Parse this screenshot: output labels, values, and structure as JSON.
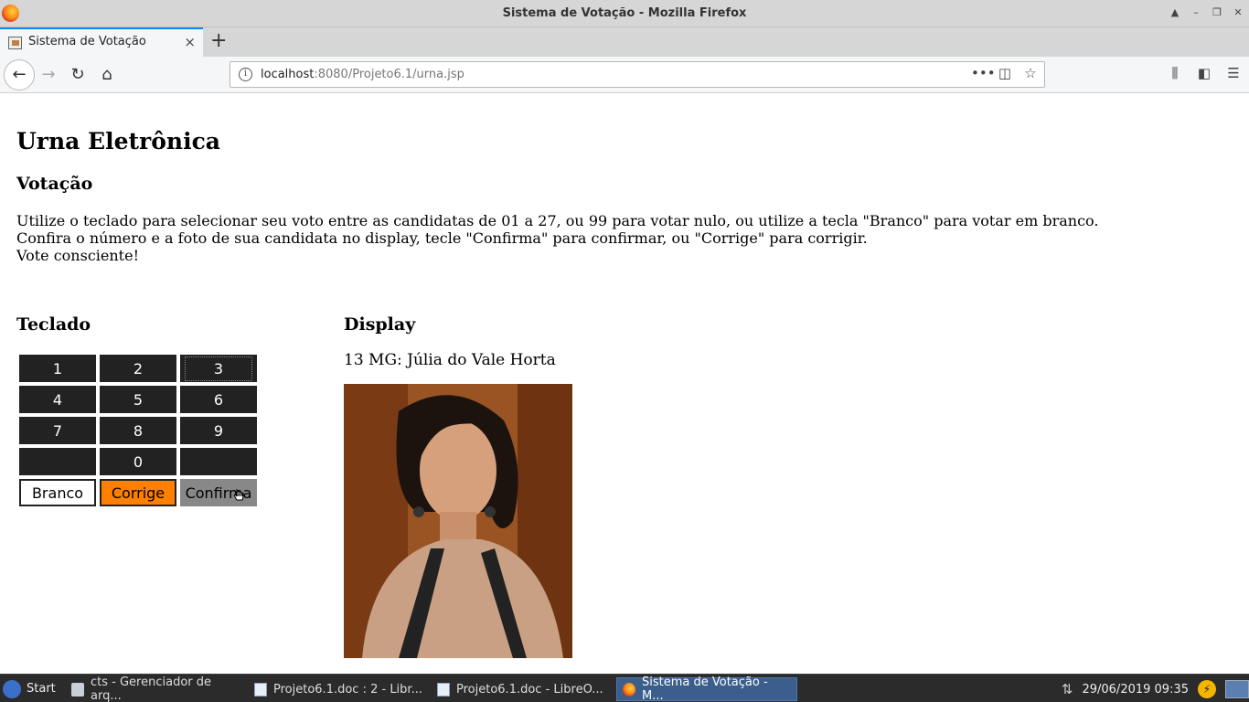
{
  "window": {
    "title": "Sistema de Votação - Mozilla Firefox",
    "controls": [
      "▲",
      "–",
      "❐",
      "✕"
    ]
  },
  "tab": {
    "label": "Sistema de Votação",
    "close": "×",
    "new_tab": "+"
  },
  "nav": {
    "back": "←",
    "forward": "→",
    "reload": "↻",
    "home": "⌂",
    "url_host": "localhost",
    "url_rest": ":8080/Projeto6.1/urna.jsp",
    "url_icons": [
      "•••",
      "◫",
      "☆"
    ],
    "right_icons": [
      "⫼",
      "◧",
      "☰"
    ]
  },
  "page": {
    "heading": "Urna Eletrônica",
    "votacao_heading": "Votação",
    "instructions": [
      "Utilize o teclado para selecionar seu voto entre as candidatas de 01 a 27, ou 99 para votar nulo, ou utilize a tecla \"Branco\" para votar em branco.",
      "Confira o número e a foto de sua candidata no display, tecle \"Confirma\" para confirmar, ou \"Corrige\" para corrigir.",
      "Vote consciente!"
    ],
    "teclado_heading": "Teclado",
    "display_heading": "Display",
    "candidate_text": "13 MG: Júlia do Vale Horta",
    "keys": {
      "k1": "1",
      "k2": "2",
      "k3": "3",
      "k4": "4",
      "k5": "5",
      "k6": "6",
      "k7": "7",
      "k8": "8",
      "k9": "9",
      "k0": "0",
      "branco": "Branco",
      "corrige": "Corrige",
      "confirma": "Confirma"
    },
    "colors": {
      "key_bg": "#222222",
      "corrige_bg": "#ff7f00",
      "confirma_bg": "#888888"
    }
  },
  "taskbar": {
    "start": "Start",
    "tasks": [
      "cts - Gerenciador de arq...",
      "Projeto6.1.doc : 2 - Libr...",
      "Projeto6.1.doc - LibreO...",
      "Sistema de Votação - M..."
    ],
    "clock": "29/06/2019 09:35"
  }
}
